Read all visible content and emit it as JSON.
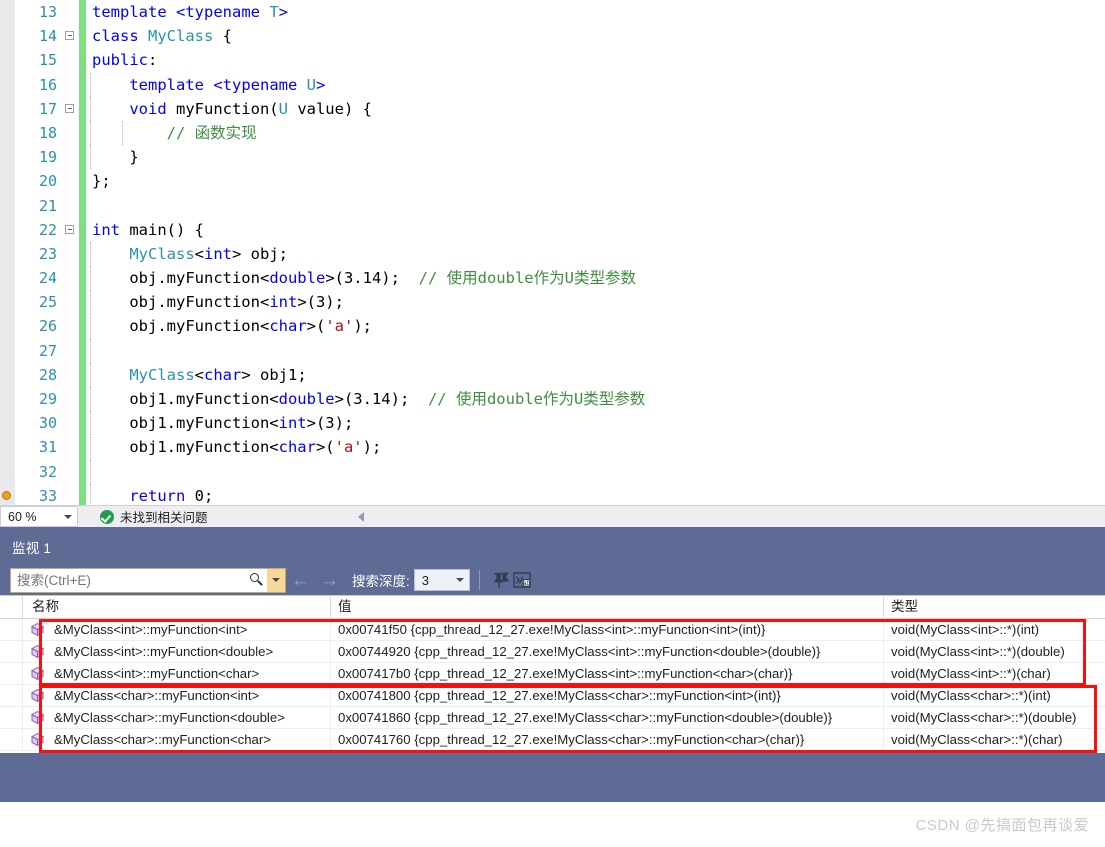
{
  "editor": {
    "zoom_level": "60 %",
    "status_message": "未找到相关问题",
    "lines": [
      {
        "no": "13",
        "html": "<span class=\"kw\">template</span> <span class=\"kw\">&lt;typename</span> <span class=\"typ\">T</span><span class=\"kw\">&gt;</span>",
        "text": "template <typename T>",
        "fold": "none",
        "indent": 0
      },
      {
        "no": "14",
        "html": "<span class=\"kw\">class</span> <span class=\"typ\">MyClass</span> {",
        "text": "class MyClass {",
        "fold": "open",
        "indent": 0
      },
      {
        "no": "15",
        "html": "<span class=\"kw\">public</span>:",
        "text": "public:",
        "fold": "bar",
        "indent": 0
      },
      {
        "no": "16",
        "html": "    <span class=\"kw\">template</span> <span class=\"kw\">&lt;typename</span> <span class=\"typ\">U</span><span class=\"kw\">&gt;</span>",
        "text": "    template <typename U>",
        "fold": "bar",
        "indent": 1
      },
      {
        "no": "17",
        "html": "    <span class=\"kw\">void</span> myFunction(<span class=\"typ\">U</span> value) {",
        "text": "    void myFunction(U value) {",
        "fold": "open2",
        "indent": 1
      },
      {
        "no": "18",
        "html": "        <span class=\"cmt\">// 函数实现</span>",
        "text": "        // 函数实现",
        "fold": "bar",
        "indent": 2
      },
      {
        "no": "19",
        "html": "    }",
        "text": "    }",
        "fold": "bar",
        "indent": 1
      },
      {
        "no": "20",
        "html": "};",
        "text": "};",
        "fold": "close",
        "indent": 0
      },
      {
        "no": "21",
        "html": "",
        "text": "",
        "fold": "none",
        "indent": 0
      },
      {
        "no": "22",
        "html": "<span class=\"kw\">int</span> main() {",
        "text": "int main() {",
        "fold": "open",
        "indent": 0
      },
      {
        "no": "23",
        "html": "    <span class=\"typ\">MyClass</span>&lt;<span class=\"kw\">int</span>&gt; obj;",
        "text": "    MyClass<int> obj;",
        "fold": "bar",
        "indent": 1
      },
      {
        "no": "24",
        "html": "    obj.myFunction&lt;<span class=\"kw\">double</span>&gt;(3.14);  <span class=\"cmt\">// 使用double作为U类型参数</span>",
        "text": "    obj.myFunction<double>(3.14);  // 使用double作为U类型参数",
        "fold": "bar",
        "indent": 1
      },
      {
        "no": "25",
        "html": "    obj.myFunction&lt;<span class=\"kw\">int</span>&gt;(3);",
        "text": "    obj.myFunction<int>(3);",
        "fold": "bar",
        "indent": 1
      },
      {
        "no": "26",
        "html": "    obj.myFunction&lt;<span class=\"kw\">char</span>&gt;(<span class=\"str\">'a'</span>);",
        "text": "    obj.myFunction<char>('a');",
        "fold": "bar",
        "indent": 1
      },
      {
        "no": "27",
        "html": "",
        "text": "",
        "fold": "bar",
        "indent": 1
      },
      {
        "no": "28",
        "html": "    <span class=\"typ\">MyClass</span>&lt;<span class=\"kw\">char</span>&gt; obj1;",
        "text": "    MyClass<char> obj1;",
        "fold": "bar",
        "indent": 1
      },
      {
        "no": "29",
        "html": "    obj1.myFunction&lt;<span class=\"kw\">double</span>&gt;(3.14);  <span class=\"cmt\">// 使用double作为U类型参数</span>",
        "text": "    obj1.myFunction<double>(3.14);  // 使用double作为U类型参数",
        "fold": "bar",
        "indent": 1
      },
      {
        "no": "30",
        "html": "    obj1.myFunction&lt;<span class=\"kw\">int</span>&gt;(3);",
        "text": "    obj1.myFunction<int>(3);",
        "fold": "bar",
        "indent": 1
      },
      {
        "no": "31",
        "html": "    obj1.myFunction&lt;<span class=\"kw\">char</span>&gt;(<span class=\"str\">'a'</span>);",
        "text": "    obj1.myFunction<char>('a');",
        "fold": "bar",
        "indent": 1
      },
      {
        "no": "32",
        "html": "",
        "text": "",
        "fold": "bar",
        "indent": 1
      },
      {
        "no": "33",
        "html": "    <span class=\"kw\">return</span> <span class=\"num\">0</span>;",
        "text": "    return 0;",
        "fold": "bar",
        "indent": 1,
        "breakpoint": true
      }
    ]
  },
  "watch": {
    "title": "监视 1",
    "search_placeholder": "搜索(Ctrl+E)",
    "search_value": "",
    "back_arrow": "←",
    "forward_arrow": "→",
    "depth_label": "搜索深度:",
    "depth_value": "3",
    "columns": [
      "名称",
      "值",
      "类型"
    ],
    "rows": [
      {
        "name": "&MyClass<int>::myFunction<int>",
        "value": "0x00741f50 {cpp_thread_12_27.exe!MyClass<int>::myFunction<int>(int)}",
        "type": "void(MyClass<int>::*)(int)"
      },
      {
        "name": "&MyClass<int>::myFunction<double>",
        "value": "0x00744920 {cpp_thread_12_27.exe!MyClass<int>::myFunction<double>(double)}",
        "type": "void(MyClass<int>::*)(double)"
      },
      {
        "name": "&MyClass<int>::myFunction<char>",
        "value": "0x007417b0 {cpp_thread_12_27.exe!MyClass<int>::myFunction<char>(char)}",
        "type": "void(MyClass<int>::*)(char)"
      },
      {
        "name": "&MyClass<char>::myFunction<int>",
        "value": "0x00741800 {cpp_thread_12_27.exe!MyClass<char>::myFunction<int>(int)}",
        "type": "void(MyClass<char>::*)(int)"
      },
      {
        "name": "&MyClass<char>::myFunction<double>",
        "value": "0x00741860 {cpp_thread_12_27.exe!MyClass<char>::myFunction<double>(double)}",
        "type": "void(MyClass<char>::*)(double)"
      },
      {
        "name": "&MyClass<char>::myFunction<char>",
        "value": "0x00741760 {cpp_thread_12_27.exe!MyClass<char>::myFunction<char>(char)}",
        "type": "void(MyClass<char>::*)(char)"
      }
    ]
  },
  "footer": {
    "watermark": "CSDN @先搞面包再谈爱"
  },
  "colors": {
    "panel_blue": "#5e6b94",
    "keyword": "#0000ff",
    "type": "#2b91af",
    "comment": "#3f8f3f",
    "string": "#a31515",
    "annotation_red": "#fa0f0f",
    "change_bar_green": "#7ee07e"
  }
}
